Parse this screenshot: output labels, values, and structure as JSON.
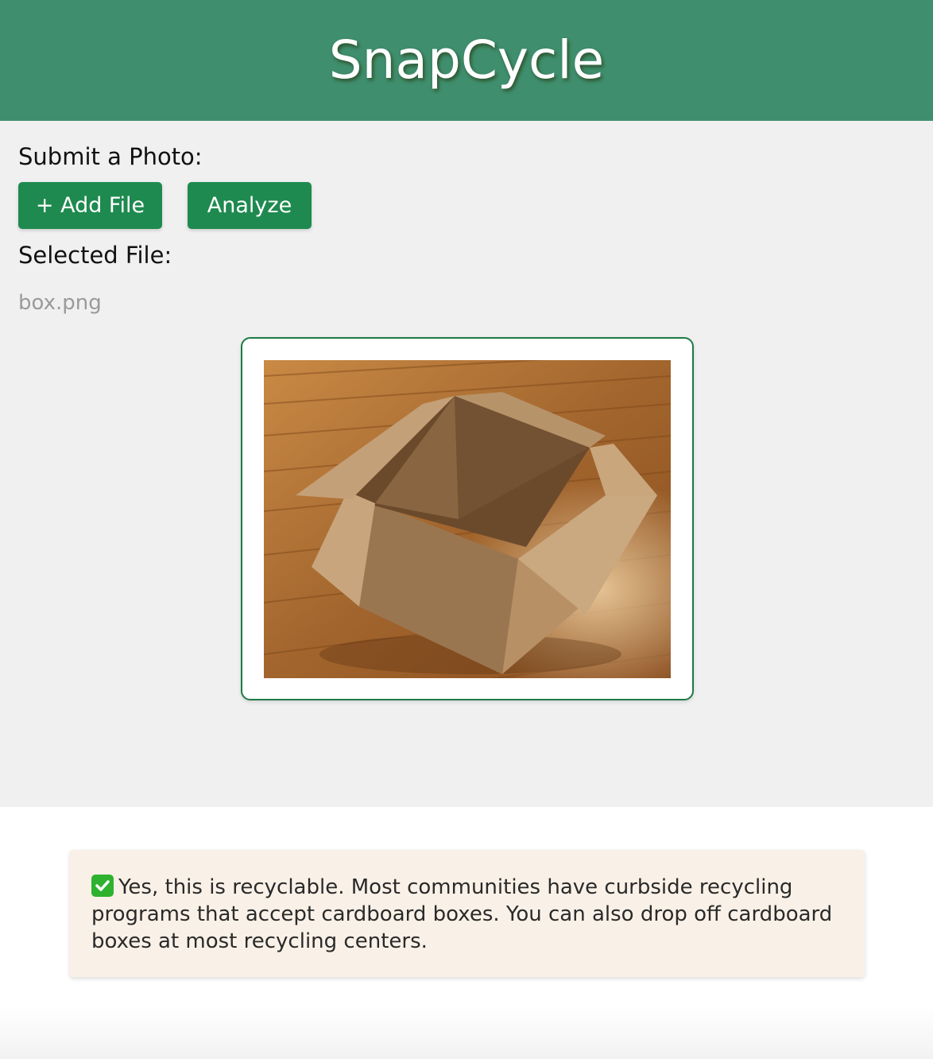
{
  "header": {
    "title": "SnapCycle",
    "background_color": "#3f8f6e"
  },
  "upload": {
    "submit_label": "Submit a Photo:",
    "add_file_label": "+ Add File",
    "analyze_label": "Analyze",
    "selected_label": "Selected File:",
    "filename": "box.png",
    "button_color": "#1e8a4f"
  },
  "preview": {
    "image_subject": "open cardboard box on wooden floor",
    "border_color": "#1e7a45"
  },
  "result": {
    "icon": "check-mark-icon",
    "message": "Yes, this is recyclable. Most communities have curbside recycling programs that accept cardboard boxes. You can also drop off cardboard boxes at most recycling centers.",
    "background_color": "#f9f1e7"
  }
}
